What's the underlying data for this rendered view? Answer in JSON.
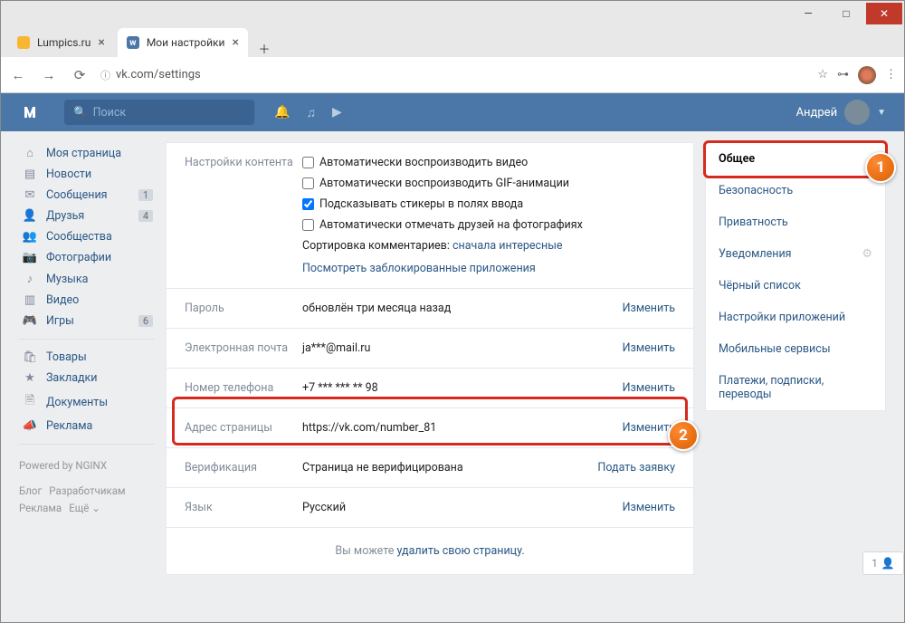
{
  "window": {
    "tabs": [
      {
        "title": "Lumpics.ru",
        "active": false
      },
      {
        "title": "Мои настройки",
        "active": true
      }
    ],
    "url": "vk.com/settings"
  },
  "header": {
    "search_placeholder": "Поиск",
    "user_name": "Андрей"
  },
  "left_nav": {
    "items": [
      {
        "icon": "home-icon",
        "glyph": "⌂",
        "label": "Моя страница",
        "badge": ""
      },
      {
        "icon": "news-icon",
        "glyph": "▤",
        "label": "Новости",
        "badge": ""
      },
      {
        "icon": "messages-icon",
        "glyph": "✉",
        "label": "Сообщения",
        "badge": "1"
      },
      {
        "icon": "friends-icon",
        "glyph": "👤",
        "label": "Друзья",
        "badge": "4"
      },
      {
        "icon": "communities-icon",
        "glyph": "👥",
        "label": "Сообщества",
        "badge": ""
      },
      {
        "icon": "photos-icon",
        "glyph": "📷",
        "label": "Фотографии",
        "badge": ""
      },
      {
        "icon": "music-icon",
        "glyph": "♪",
        "label": "Музыка",
        "badge": ""
      },
      {
        "icon": "videos-icon",
        "glyph": "▥",
        "label": "Видео",
        "badge": ""
      },
      {
        "icon": "games-icon",
        "glyph": "🎮",
        "label": "Игры",
        "badge": "6"
      }
    ],
    "items2": [
      {
        "icon": "market-icon",
        "glyph": "🛍",
        "label": "Товары"
      },
      {
        "icon": "bookmarks-icon",
        "glyph": "★",
        "label": "Закладки"
      },
      {
        "icon": "docs-icon",
        "glyph": "🗎",
        "label": "Документы"
      },
      {
        "icon": "ads-icon",
        "glyph": "📣",
        "label": "Реклама"
      }
    ],
    "powered": "Powered by NGINX",
    "footer_links": [
      "Блог",
      "Разработчикам",
      "Реклама",
      "Ещё ⌄"
    ]
  },
  "right_nav": {
    "items": [
      "Общее",
      "Безопасность",
      "Приватность",
      "Уведомления",
      "Чёрный список",
      "Настройки приложений",
      "Мобильные сервисы",
      "Платежи, подписки, переводы"
    ]
  },
  "content": {
    "section_label": "Настройки контента",
    "checks": [
      {
        "label": "Автоматически воспроизводить видео",
        "checked": false
      },
      {
        "label": "Автоматически воспроизводить GIF-анимации",
        "checked": false
      },
      {
        "label": "Подсказывать стикеры в полях ввода",
        "checked": true
      },
      {
        "label": "Автоматически отмечать друзей на фотографиях",
        "checked": false
      }
    ],
    "sort_label": "Сортировка комментариев:",
    "sort_value": "сначала интересные",
    "blocked_apps": "Посмотреть заблокированные приложения",
    "rows": [
      {
        "label": "Пароль",
        "value": "обновлён три месяца назад",
        "action": "Изменить"
      },
      {
        "label": "Электронная почта",
        "value": "ja***@mail.ru",
        "action": "Изменить"
      },
      {
        "label": "Номер телефона",
        "value": "+7 *** *** ** 98",
        "action": "Изменить"
      },
      {
        "label": "Адрес страницы",
        "value": "https://vk.com/number_81",
        "action": "Изменить"
      },
      {
        "label": "Верификация",
        "value": "Страница не верифицирована",
        "action": "Подать заявку"
      },
      {
        "label": "Язык",
        "value": "Русский",
        "action": "Изменить"
      }
    ],
    "delete_prefix": "Вы можете ",
    "delete_link": "удалить свою страницу."
  },
  "floating": {
    "count": "1",
    "glyph": "↑"
  },
  "annot": {
    "one": "1",
    "two": "2"
  }
}
